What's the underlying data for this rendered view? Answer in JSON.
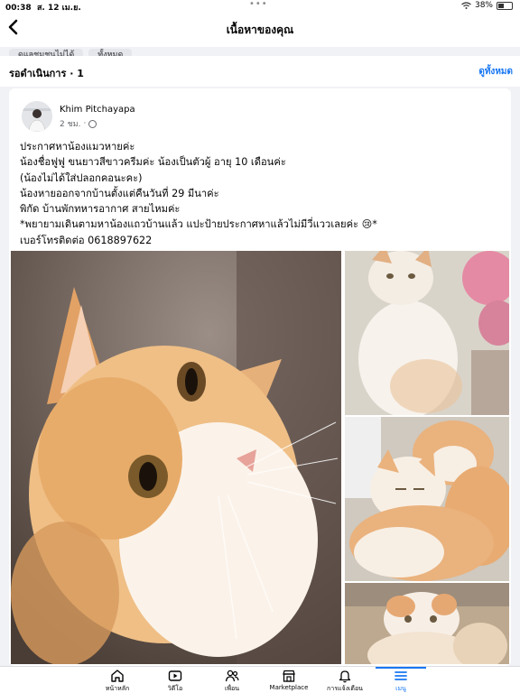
{
  "status_bar": {
    "time": "00:38",
    "date": "ส. 12 เม.ย.",
    "battery": "38%"
  },
  "header": {
    "title": "เนื้อหาของคุณ",
    "chips": [
      "ดแลชุมชนไม่ได้",
      "ทั้งหมด"
    ]
  },
  "section": {
    "label": "รอดำเนินการ",
    "count": "1",
    "see_all": "ดูทั้งหมด"
  },
  "post": {
    "author": "Khim Pitchayapa",
    "time": "2 ชม.",
    "lines": [
      "ประกาศหาน้องแมวหายค่ะ",
      "น้องชื่อฟูฟู  ขนยาวสีขาวครีมค่ะ น้องเป็นตัวผู้ อายุ 10 เดือนค่ะ",
      "(น้องไม่ได้ใส่ปลอกคอนะคะ)",
      "น้องหายออกจากบ้านตั้งแต่คืนวันที่ 29 มีนาค่ะ",
      "พิกัด บ้านพักทหารอากาศ สายไหมค่ะ",
      "*พยายามเดินตามหาน้องแถวบ้านแล้ว แปะป้ายประกาศหาแล้วไม่มีวี่แววเลยค่ะ 😢*",
      "เบอร์โทรติดต่อ 0618897622"
    ]
  },
  "tabs": [
    {
      "label": "หน้าหลัก",
      "icon": "home-icon"
    },
    {
      "label": "วิดีโอ",
      "icon": "video-icon"
    },
    {
      "label": "เพื่อน",
      "icon": "friends-icon"
    },
    {
      "label": "Marketplace",
      "icon": "marketplace-icon"
    },
    {
      "label": "การแจ้งเตือน",
      "icon": "bell-icon"
    },
    {
      "label": "เมนู",
      "icon": "menu-icon"
    }
  ],
  "colors": {
    "accent": "#1877f2",
    "background": "#f0f2f5"
  }
}
